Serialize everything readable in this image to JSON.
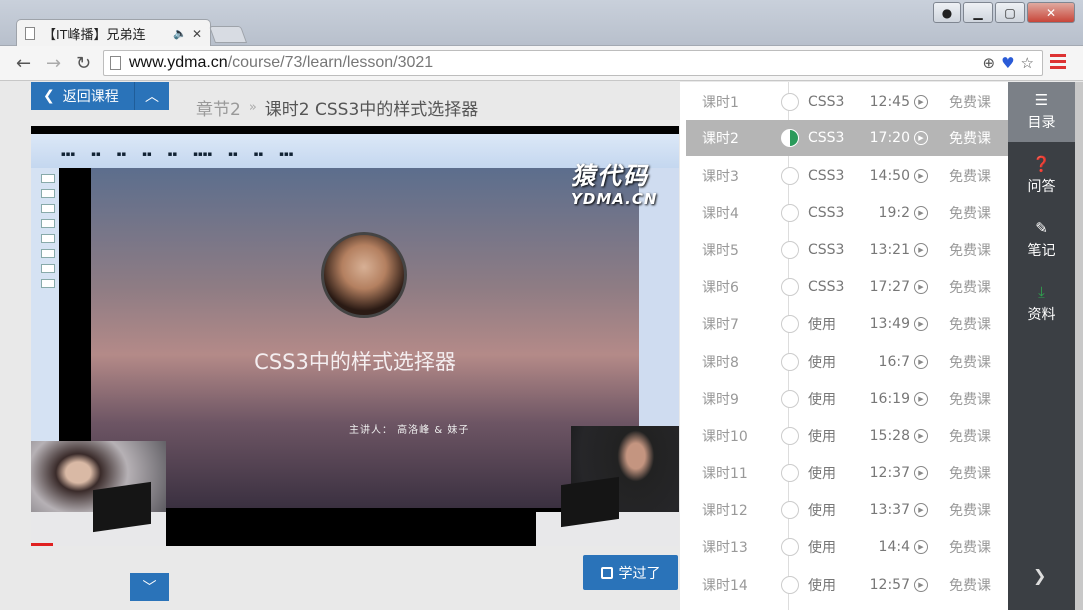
{
  "browser": {
    "tab_title": "【IT峰播】兄弟连",
    "tab_audio_icon": "speaker-icon",
    "url_host": "www.ydma.cn",
    "url_path": "/course/73/learn/lesson/3021"
  },
  "page": {
    "back_label": "返回课程",
    "chapter": "章节2",
    "crumb_sep": "»",
    "lesson_title": "课时2  CSS3中的样式选择器",
    "learned_label": "学过了"
  },
  "video": {
    "watermark_cn": "猿代码",
    "watermark_en": "YDMA.CN",
    "slide_title": "CSS3中的样式选择器",
    "slide_subtitle": "主讲人：  高洛峰  &  妹子"
  },
  "lessons": [
    {
      "num": "课时1",
      "tag": "CSS3",
      "dur": "12:45",
      "free": "免费课"
    },
    {
      "num": "课时2",
      "tag": "CSS3",
      "dur": "17:20",
      "free": "免费课",
      "active": true
    },
    {
      "num": "课时3",
      "tag": "CSS3",
      "dur": "14:50",
      "free": "免费课"
    },
    {
      "num": "课时4",
      "tag": "CSS3",
      "dur": "19:2",
      "free": "免费课"
    },
    {
      "num": "课时5",
      "tag": "CSS3",
      "dur": "13:21",
      "free": "免费课"
    },
    {
      "num": "课时6",
      "tag": "CSS3",
      "dur": "17:27",
      "free": "免费课"
    },
    {
      "num": "课时7",
      "tag": "使用",
      "dur": "13:49",
      "free": "免费课"
    },
    {
      "num": "课时8",
      "tag": "使用",
      "dur": "16:7",
      "free": "免费课"
    },
    {
      "num": "课时9",
      "tag": "使用",
      "dur": "16:19",
      "free": "免费课"
    },
    {
      "num": "课时10",
      "tag": "使用",
      "dur": "15:28",
      "free": "免费课"
    },
    {
      "num": "课时11",
      "tag": "使用",
      "dur": "12:37",
      "free": "免费课"
    },
    {
      "num": "课时12",
      "tag": "使用",
      "dur": "13:37",
      "free": "免费课"
    },
    {
      "num": "课时13",
      "tag": "使用",
      "dur": "14:4",
      "free": "免费课"
    },
    {
      "num": "课时14",
      "tag": "使用",
      "dur": "12:57",
      "free": "免费课"
    }
  ],
  "side_nav": [
    {
      "label": "目录",
      "icon": "list-icon"
    },
    {
      "label": "问答",
      "icon": "question-icon"
    },
    {
      "label": "笔记",
      "icon": "edit-icon"
    },
    {
      "label": "资料",
      "icon": "download-icon"
    }
  ],
  "colors": {
    "accent_blue": "#2a73b9",
    "sidebar_dark": "#3b3f44",
    "active_row": "#b5b5b5"
  }
}
